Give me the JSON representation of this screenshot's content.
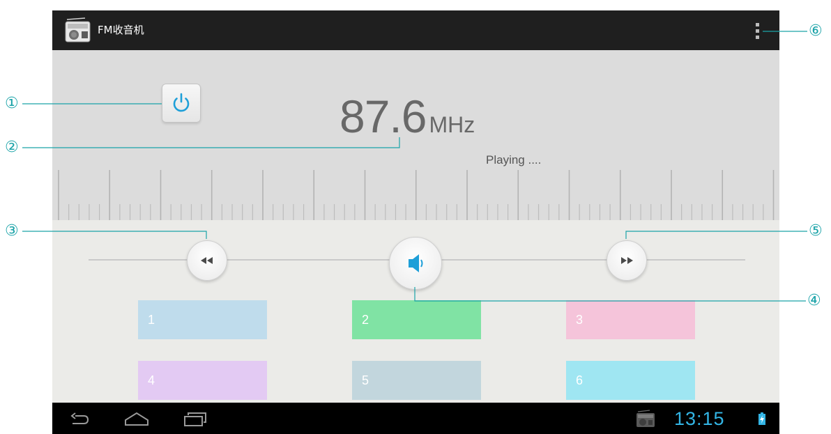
{
  "app": {
    "title": "FM收音机",
    "icon": "radio-icon"
  },
  "menu": {
    "icon": "overflow-menu-icon"
  },
  "radio": {
    "frequency": "87.6",
    "unit": "MHz",
    "status": "Playing ....",
    "power_icon": "power-icon"
  },
  "controls": {
    "prev_icon": "seek-back-icon",
    "volume_icon": "speaker-icon",
    "next_icon": "seek-forward-icon"
  },
  "presets": [
    {
      "label": "1",
      "color": "#bfdcec"
    },
    {
      "label": "2",
      "color": "#80e3a4"
    },
    {
      "label": "3",
      "color": "#f5c4da"
    },
    {
      "label": "4",
      "color": "#e3caf3"
    },
    {
      "label": "5",
      "color": "#c2d6dd"
    },
    {
      "label": "6",
      "color": "#9fe6f2"
    }
  ],
  "navbar": {
    "back_icon": "back-icon",
    "home_icon": "home-icon",
    "recents_icon": "recents-icon",
    "notification_icon": "radio-notification-icon",
    "time": "13:15",
    "battery_icon": "battery-charging-icon"
  },
  "callouts": [
    "①",
    "②",
    "③",
    "④",
    "⑤",
    "⑥"
  ],
  "colors": {
    "accent": "#33b5e5",
    "callout": "#1aa3a8",
    "actionbar": "#1f1f1f"
  }
}
